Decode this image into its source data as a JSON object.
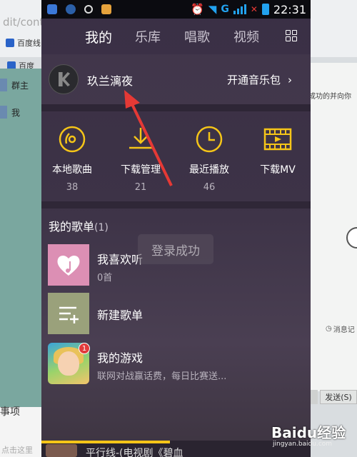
{
  "background": {
    "url_fragment": "dit/cont",
    "bookmark_1": "百度线",
    "bookmark_2": "百度",
    "chat_items": [
      "群主",
      "我"
    ],
    "right_text": "成功的并向你",
    "right_msg": "消息记",
    "send_button": "发送(S)",
    "bottom_text": "事项",
    "bottom_input": "点击这里"
  },
  "status_bar": {
    "time": "22:31",
    "network": "G"
  },
  "nav": {
    "tabs": [
      "我的",
      "乐库",
      "唱歌",
      "视频"
    ],
    "active_tab": "我的"
  },
  "profile": {
    "username": "玖兰漓夜",
    "open_pack_label": "开通音乐包"
  },
  "quick_access": [
    {
      "label": "本地歌曲",
      "count": "38",
      "icon": "disc-icon"
    },
    {
      "label": "下载管理",
      "count": "21",
      "icon": "download-icon"
    },
    {
      "label": "最近播放",
      "count": "46",
      "icon": "clock-icon"
    },
    {
      "label": "下载MV",
      "count": "",
      "icon": "film-icon"
    }
  ],
  "playlists": {
    "header": "我的歌单",
    "count": "(1)",
    "items": [
      {
        "title": "我喜欢听",
        "subtitle": "0首"
      },
      {
        "title": "新建歌单",
        "subtitle": ""
      },
      {
        "title": "我的游戏",
        "subtitle": "联网对战赢话费，每日比赛送...",
        "badge": "1"
      }
    ]
  },
  "toast": "登录成功",
  "player": {
    "now_playing": "平行线-(电视剧《碧血"
  },
  "watermark": {
    "brand": "Baidu经验",
    "site": "jingyan.baidu.com"
  },
  "colors": {
    "accent_yellow": "#f5c518",
    "status_blue": "#22a2ef",
    "arrow_red": "#e53935"
  }
}
